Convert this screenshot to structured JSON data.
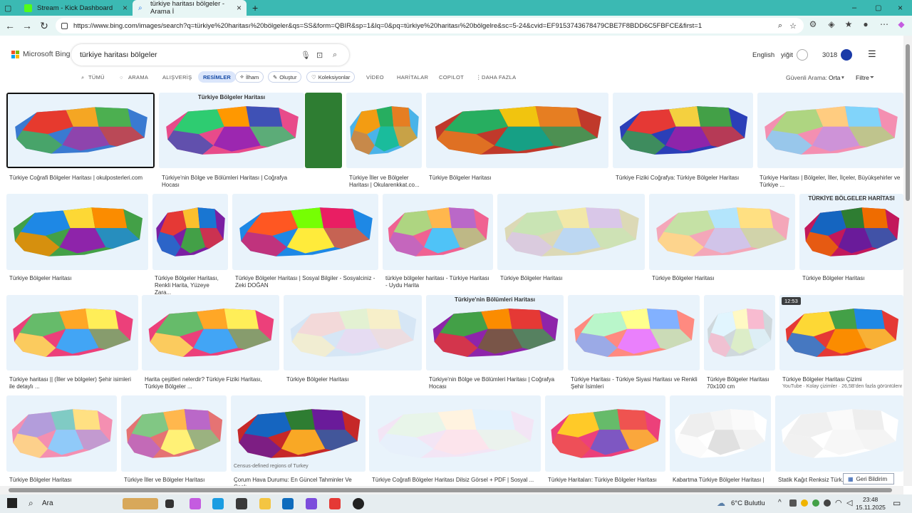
{
  "browser": {
    "tabs": [
      {
        "label": "Stream - Kick Dashboard"
      },
      {
        "label": "türkiye haritası bölgeler - Arama İ"
      }
    ],
    "url": "https://www.bing.com/images/search?q=türkiye%20haritası%20bölgeler&qs=SS&form=QBIR&sp=1&lq=0&pq=türkiye%20haritası%20bölgelre&sc=5-24&cvid=EF9153743678479CBE7F8BDD6C5FBFCE&first=1"
  },
  "bing": {
    "logo": "Microsoft Bing",
    "query": "türkiye haritası bölgeler",
    "language": "English",
    "user": "yiğit",
    "points": "3018",
    "filters": [
      "TÜMÜ",
      "ARAMA",
      "ALIŞVERİŞ",
      "RESİMLER",
      "İlham",
      "Oluştur",
      "Koleksiyonlar",
      "VİDEO",
      "HARİTALAR",
      "COPILOT",
      "DAHA FAZLA"
    ],
    "safe_label": "Güvenli Arama:",
    "safe_value": "Orta",
    "filter_label": "Filtre",
    "feedback": "Geri Bildirim"
  },
  "results": [
    {
      "caption": "Türkiye Coğrafi Bölgeler Haritası | okulposterleri.com",
      "colors": [
        "#3a7ad1",
        "#e63a2e",
        "#f5a623",
        "#4caf50",
        "#8e44ad"
      ]
    },
    {
      "caption": "Türkiye'nin Bölge ve Bölümleri Haritası | Coğrafya Hocası",
      "banner": "Türkiye Bölgeler Haritası",
      "colors": [
        "#e84b8a",
        "#2ecc71",
        "#ff9800",
        "#3f51b5",
        "#9c27b0"
      ]
    },
    {
      "caption": "Türkiye İller ve Bölgeler Haritası | Okularenkkat.co...",
      "colors": [
        "#4ab3e8",
        "#f39c12",
        "#27ae60",
        "#e67e22",
        "#1abc9c"
      ]
    },
    {
      "caption": "Türkiye Bölgeler Haritası",
      "colors": [
        "#c0392b",
        "#27ae60",
        "#f1c40f",
        "#e67e22",
        "#16a085"
      ]
    },
    {
      "caption": "Türkiye Fiziki Coğrafya: Türkiye Bölgeler Haritası",
      "colors": [
        "#2b3fb8",
        "#e53935",
        "#f4d03f",
        "#43a047",
        "#8e24aa"
      ]
    },
    {
      "caption": "Türkiye Haritası | Bölgeler, İller, İlçeler, Büyükşehirler ve Türkiye ...",
      "colors": [
        "#f48fb1",
        "#aed581",
        "#ffcc80",
        "#81d4fa",
        "#ce93d8"
      ]
    },
    {
      "caption": "Türkiye Bölgeler Haritası",
      "colors": [
        "#43a047",
        "#1e88e5",
        "#fdd835",
        "#fb8c00",
        "#8e24aa"
      ]
    },
    {
      "caption": "Türkiye Bölgeler Haritası, Renkli Harita, Yüzeye Zara...",
      "colors": [
        "#7b1fa2",
        "#e53935",
        "#fbc02d",
        "#1976d2",
        "#43a047"
      ]
    },
    {
      "caption": "Türkiye Bölgeler Haritası | Sosyal Bilgiler - Sosyalciniz - Zeki DOĞAN",
      "colors": [
        "#1e88e5",
        "#ff5722",
        "#76ff03",
        "#e91e63",
        "#ffeb3b"
      ]
    },
    {
      "caption": "türkiye bölgeler haritası - Türkiye Haritası - Uydu Harita",
      "colors": [
        "#f06292",
        "#aed581",
        "#ffb74d",
        "#ba68c8",
        "#4fc3f7"
      ]
    },
    {
      "caption": "Türkiye Bölgeler Haritası",
      "colors": [
        "#dcd9b6",
        "#c9e4b4",
        "#f2e8a8",
        "#d9c7e8",
        "#bcd7f2"
      ]
    },
    {
      "caption": "Türkiye Bölgeler Haritası",
      "colors": [
        "#f4a7b9",
        "#c5e1a5",
        "#b3e5fc",
        "#ffe082",
        "#d1c4e9"
      ]
    },
    {
      "caption": "Türkiye Bölgeler Haritası",
      "banner": "TÜRKİYE BÖLGELER HARİTASI",
      "colors": [
        "#c2185b",
        "#1565c0",
        "#2e7d32",
        "#ef6c00",
        "#6a1b9a"
      ]
    },
    {
      "caption": "Türkiye haritası || (İller ve bölgeler) Şehir isimleri ile detaylı ...",
      "colors": [
        "#ec407a",
        "#66bb6a",
        "#ffa726",
        "#ffee58",
        "#42a5f5"
      ]
    },
    {
      "caption": "Harita çeşitleri nelerdir? Türkiye Fiziki Haritası, Türkiye Bölgeler ...",
      "colors": [
        "#ec407a",
        "#66bb6a",
        "#ffa726",
        "#ffee58",
        "#42a5f5"
      ]
    },
    {
      "caption": "Türkiye Bölgeler Haritası",
      "colors": [
        "#d6e6f5",
        "#f3d9d9",
        "#e3f1d2",
        "#f7efc9",
        "#e6dcf2"
      ]
    },
    {
      "caption": "Türkiye'nin Bölge ve Bölümleri Haritası | Coğrafya Hocası",
      "banner": "Türkiye'nin Bölümleri Haritası",
      "colors": [
        "#8e24aa",
        "#43a047",
        "#fb8c00",
        "#e53935",
        "#795548"
      ]
    },
    {
      "caption": "Türkiye Haritası - Türkiye Siyasi Haritası ve Renkli Şehir İsimleri",
      "colors": [
        "#ff8a80",
        "#b9f6ca",
        "#ffff8d",
        "#82b1ff",
        "#ea80fc"
      ]
    },
    {
      "caption": "Türkiye Bölgeler Haritası 70x100 cm",
      "colors": [
        "#cfd8dc",
        "#e1f5fe",
        "#fff9c4",
        "#f8bbd0",
        "#dcedc8"
      ]
    },
    {
      "caption": "Türkiye Bölgeler Haritası Çizimi",
      "sub": "YouTube · Kolay çizimler · 26,5B'den fazla görüntülenmi · 4 E...",
      "badge": "12:53",
      "colors": [
        "#e53935",
        "#fdd835",
        "#43a047",
        "#1e88e5",
        "#fb8c00"
      ]
    },
    {
      "caption": "Türkiye Bölgeler Haritası",
      "colors": [
        "#f48fb1",
        "#b39ddb",
        "#80cbc4",
        "#ffe082",
        "#90caf9"
      ]
    },
    {
      "caption": "Türkiye İller ve Bölgeler Haritası",
      "colors": [
        "#e57373",
        "#81c784",
        "#ffb74d",
        "#ba68c8",
        "#fff176"
      ]
    },
    {
      "caption": "Çorum Hava Durumu: En Güncel Tahminler Ve Canlı ...",
      "sub": "Census-defined regions of Turkey",
      "colors": [
        "#c62828",
        "#1565c0",
        "#2e7d32",
        "#6a1b9a",
        "#f9a825"
      ]
    },
    {
      "caption": "Türkiye Coğrafi Bölgeler Haritası Dilsiz Görsel + PDF | Sosyal ...",
      "colors": [
        "#f3e5f5",
        "#e8f5e9",
        "#fff3e0",
        "#e3f2fd",
        "#fce4ec"
      ]
    },
    {
      "caption": "Türkiye Haritaları: Türkiye Bölgeler Haritası",
      "colors": [
        "#ec407a",
        "#ffca28",
        "#66bb6a",
        "#ef5350",
        "#7e57c2"
      ]
    },
    {
      "caption": "Kabartma Türkiye Bölgeler Haritası | ...",
      "colors": [
        "#ffffff",
        "#eeeeee",
        "#f5f5f5",
        "#fafafa",
        "#e0e0e0"
      ]
    },
    {
      "caption": "Statik Kağıt Renksiz Türk...",
      "colors": [
        "#ffffff",
        "#f0f0f0",
        "#fafafa",
        "#eeeeee",
        "#f7f7f7"
      ]
    }
  ],
  "taskbar": {
    "search": "Ara",
    "weather": "6°C Bulutlu",
    "time": "23:48",
    "date": "15.11.2025"
  }
}
